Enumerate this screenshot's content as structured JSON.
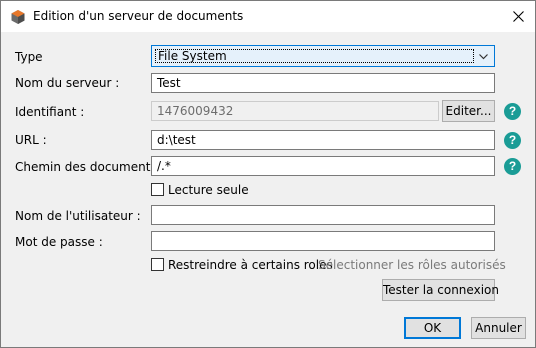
{
  "dialog": {
    "title": "Edition d'un serveur de documents"
  },
  "form": {
    "type_label": "Type",
    "type_value": "File System",
    "server_name_label": "Nom du serveur :",
    "server_name_value": "Test",
    "identifier_label": "Identifiant :",
    "identifier_value": "1476009432",
    "edit_button": "Editer...",
    "url_label": "URL :",
    "url_value": "d:\\test",
    "doc_path_label": "Chemin des documents :",
    "doc_path_value": "/.*",
    "readonly_label": "Lecture seule",
    "readonly_checked": false,
    "username_label": "Nom de l'utilisateur :",
    "username_value": "",
    "password_label": "Mot de passe :",
    "password_value": "",
    "restrict_roles_label": "Restreindre à certains roles",
    "restrict_roles_checked": false,
    "select_roles_link": "Sélectionner les rôles autorisés",
    "test_connection_button": "Tester la connexion",
    "help_symbol": "?"
  },
  "footer": {
    "ok_button": "OK",
    "cancel_button": "Annuler"
  },
  "icons": {
    "app": "app-logo-icon",
    "close": "close-icon",
    "dropdown": "chevron-down-icon",
    "help": "help-icon"
  },
  "colors": {
    "help_icon": "#1a9c96",
    "focus_accent": "#0078d7",
    "link_disabled": "#7a7a7a"
  }
}
